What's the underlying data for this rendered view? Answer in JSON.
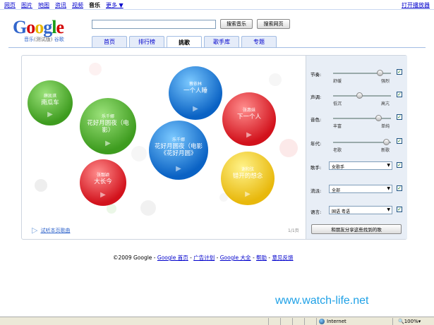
{
  "topnav": {
    "items": [
      "网页",
      "图片",
      "地图",
      "资讯",
      "视频",
      "音乐",
      "更多 ▼"
    ],
    "active": "音乐",
    "right_link": "打开播放器"
  },
  "logo": {
    "text": "Google",
    "sub_music": "音乐",
    "sub_beta": "(测试版)",
    "sub_brand": "谷歌"
  },
  "search": {
    "value": "",
    "btn_music": "搜索音乐",
    "btn_web": "搜索网页"
  },
  "tabs": [
    {
      "label": "首页",
      "active": false
    },
    {
      "label": "排行榜",
      "active": false
    },
    {
      "label": "挑歌",
      "active": true
    },
    {
      "label": "歌手库",
      "active": false
    },
    {
      "label": "专题",
      "active": false
    }
  ],
  "songs": [
    {
      "artist": "薛凯琪",
      "title": "南瓜车",
      "color": "green"
    },
    {
      "artist": "蔡依林",
      "title": "一个人睡",
      "color": "blue"
    },
    {
      "artist": "乐千娜",
      "title": "花好月圆夜（电影）",
      "color": "green"
    },
    {
      "artist": "张惠妹",
      "title": "下一个人",
      "color": "red"
    },
    {
      "artist": "乐千娜",
      "title": "花好月圆夜（电影《花好月圆》",
      "color": "blue"
    },
    {
      "artist": "张靓颖",
      "title": "大长今",
      "color": "red"
    },
    {
      "artist": "谢和弦",
      "title": "错开的想念",
      "color": "yellow"
    }
  ],
  "hint": "试听本页歌曲",
  "pager": "1/1页",
  "sliders": [
    {
      "label": "节奏:",
      "low": "舒缓",
      "high": "强烈",
      "checked": true,
      "level": 0.8
    },
    {
      "label": "声调:",
      "low": "低沉",
      "high": "高亢",
      "checked": true,
      "level": 0.45
    },
    {
      "label": "音色:",
      "low": "丰富",
      "high": "单纯",
      "checked": true,
      "level": 0.78
    },
    {
      "label": "年代:",
      "low": "老歌",
      "high": "新歌",
      "checked": true,
      "level": 0.92
    }
  ],
  "dropdowns": [
    {
      "label": "歌手:",
      "value": "女歌手",
      "checked": true
    },
    {
      "label": "流派:",
      "value": "全部",
      "checked": true
    },
    {
      "label": "语言:",
      "value": "国语 粤语",
      "checked": true
    }
  ],
  "share_button": "和朋友分享这些找到的歌",
  "footer": {
    "copyright": "©2009 Google",
    "links": [
      "Google 首页",
      "广告计划",
      "Google 大全",
      "帮助",
      "意见反馈"
    ]
  },
  "watermark": "www.watch-life.net",
  "status": {
    "zone": "Internet",
    "zoom": "100%"
  }
}
